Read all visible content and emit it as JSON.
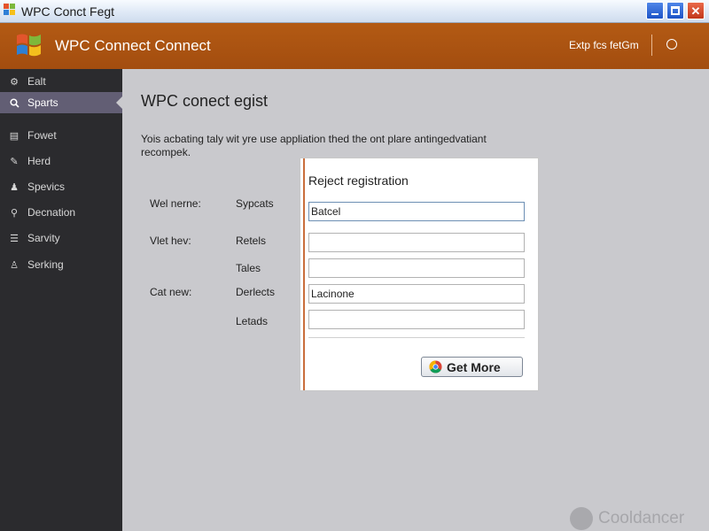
{
  "window": {
    "title": "WPC Conct Fegt"
  },
  "header": {
    "app_title": "WPC Connect Connect",
    "link_label": "Extp fcs fetGm"
  },
  "sidebar": {
    "items": [
      {
        "label": "Ealt",
        "icon": "settings-icon",
        "active": false
      },
      {
        "label": "Sparts",
        "icon": "search-icon",
        "active": true
      },
      {
        "label": "Fowet",
        "icon": "document-icon",
        "active": false
      },
      {
        "label": "Herd",
        "icon": "pen-icon",
        "active": false
      },
      {
        "label": "Spevics",
        "icon": "people-icon",
        "active": false
      },
      {
        "label": "Decnation",
        "icon": "wrench-icon",
        "active": false
      },
      {
        "label": "Sarvity",
        "icon": "list-icon",
        "active": false
      },
      {
        "label": "Serking",
        "icon": "person-icon",
        "active": false
      }
    ]
  },
  "main": {
    "title": "WPC conect egist",
    "description": "Yois acbating taly wit yre use appliation thed the ont plare antingedvatiant recompek.",
    "left_labels": [
      "Wel nerne:",
      "Vlet hev:",
      "Cat new:"
    ],
    "mid_labels": [
      "Sypcats",
      "Retels",
      "Tales",
      "Derlects",
      "Letads"
    ]
  },
  "dialog": {
    "title": "Reject registration",
    "fields": [
      {
        "value": "Batcel",
        "focused": true
      },
      {
        "value": "",
        "focused": false
      },
      {
        "value": "",
        "focused": false
      },
      {
        "value": "Lacinone",
        "focused": false
      },
      {
        "value": "",
        "focused": false
      }
    ],
    "button_label": "Get More"
  },
  "watermark": {
    "text": "Cooldancer"
  },
  "colors": {
    "header_orange": "#a8510f",
    "sidebar_bg": "#2b2b2e",
    "sidebar_active": "#625e74",
    "content_bg": "#c9c9cd"
  }
}
